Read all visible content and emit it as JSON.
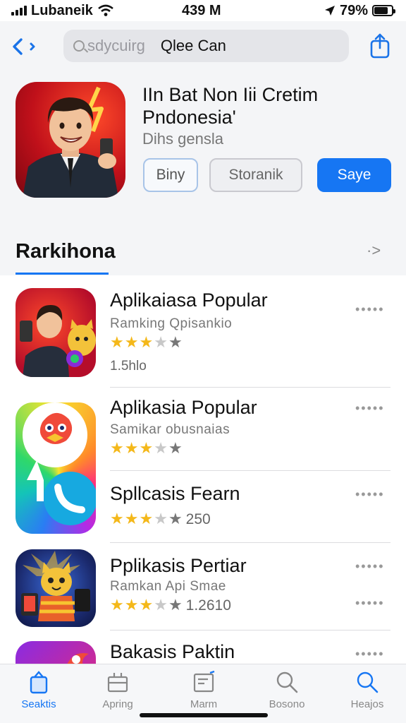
{
  "status": {
    "carrier": "Lubaneik",
    "time": "439 M",
    "battery": "79%",
    "battery_level": 0.79
  },
  "search": {
    "placeholder": "sdycuirg",
    "value": "Qlee Can"
  },
  "hero": {
    "title": "IIn Bat Non Iii Cretim Pndonesia'",
    "subtitle": "Dihs gensla",
    "buttons": {
      "buy": "Biny",
      "store": "Storanik",
      "save": "Saye"
    }
  },
  "section": {
    "title": "Rarkihona",
    "see_all": "·>"
  },
  "apps": [
    {
      "title": "Aplikaiasa Popular",
      "subtitle": "Ramking Qpisankio",
      "rating": 3.5,
      "rating_text": "",
      "meta": "1.5hlo",
      "more": "•••••"
    },
    {
      "title": "Aplikasia Popular",
      "subtitle": "Samikar obusnaias",
      "rating": 3.5,
      "rating_text": "",
      "meta": "",
      "more": "•••••"
    },
    {
      "title": "Spllcasis Fearn",
      "subtitle": "",
      "rating": 3.5,
      "rating_text": "250",
      "meta": "",
      "more": "•••••"
    },
    {
      "title": "Pplikasis Pertiar",
      "subtitle": "Ramkan Api Smae",
      "rating": 3.5,
      "rating_text": "1.2610",
      "meta": "",
      "more": "•••••"
    },
    {
      "title": "Bakasis Paktin",
      "subtitle": "",
      "rating": 0,
      "rating_text": "",
      "meta": "",
      "more": "•••••"
    }
  ],
  "tabs": [
    {
      "label": "Seaktis",
      "icon": "today-icon",
      "active": true
    },
    {
      "label": "Apring",
      "icon": "apps-icon",
      "active": false
    },
    {
      "label": "Marm",
      "icon": "arcade-icon",
      "active": false
    },
    {
      "label": "Bosono",
      "icon": "search-icon",
      "active": false
    },
    {
      "label": "Heajos",
      "icon": "search-icon",
      "active": false
    }
  ],
  "colors": {
    "accent": "#1676f3",
    "star": "#f4b81a"
  }
}
